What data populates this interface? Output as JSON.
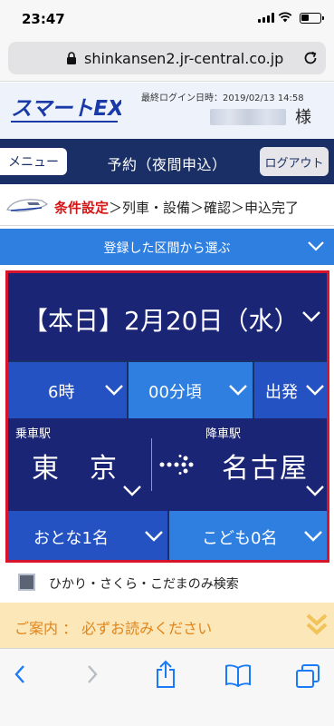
{
  "status_bar": {
    "time": "23:47"
  },
  "browser": {
    "url": "shinkansen2.jr-central.co.jp"
  },
  "site": {
    "logo_text": "スマートEX",
    "last_login": "最終ログイン日時：2019/02/13 14:58",
    "honorific": "様"
  },
  "nav": {
    "menu_label": "メニュー",
    "title": "予約（夜間申込）",
    "logout_label": "ログアウト"
  },
  "steps": {
    "active": "条件設定",
    "rest": "＞列車・設備＞確認＞申込完了"
  },
  "registered_route": {
    "label": "登録した区間から選ぶ"
  },
  "search": {
    "date": "【本日】2月20日（水）",
    "hour": "6時",
    "minute": "00分頃",
    "direction": "出発",
    "from_label": "乗車駅",
    "from_station": "東　京",
    "to_label": "降車駅",
    "to_station": "名古屋",
    "adults": "おとな1名",
    "children": "こども0名"
  },
  "filter": {
    "label": "ひかり・さくら・こだまのみ検索",
    "checked": false
  },
  "notice": {
    "label": "ご案内 ： 必ずお読みください"
  },
  "colors": {
    "navy": "#1a2f66",
    "panel": "#1b2576",
    "blue": "#2552c2",
    "light_blue": "#2f7fe0",
    "red_accent": "#d51515",
    "notice_bg": "#fbe7b8",
    "notice_text": "#e0851b"
  },
  "icons": [
    "lock-icon",
    "reload-icon",
    "train-icon",
    "chevron-down-icon",
    "arrow-right-icon",
    "back-icon",
    "forward-icon",
    "share-icon",
    "bookmarks-icon",
    "tabs-icon"
  ]
}
